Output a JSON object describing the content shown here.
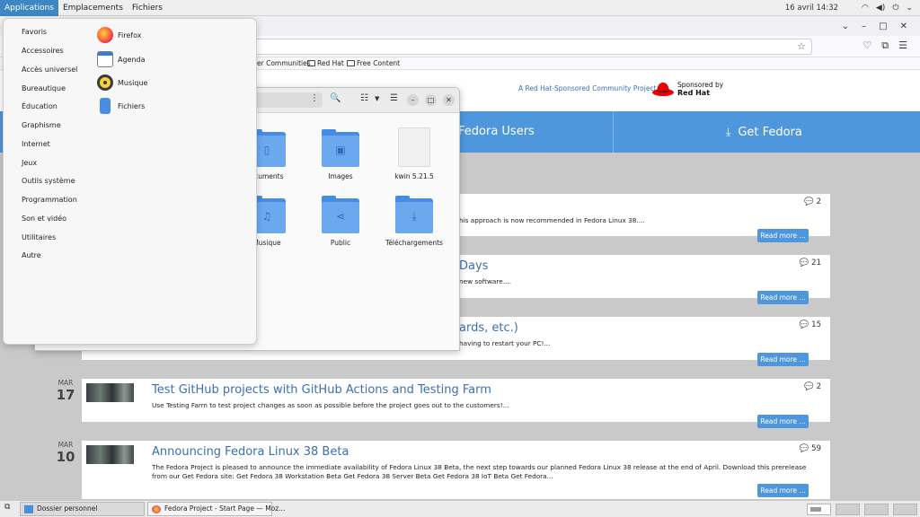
{
  "top_panel": {
    "menus": [
      "Applications",
      "Emplacements",
      "Fichiers"
    ],
    "datetime": "16 avril 14:32",
    "tray_icons": [
      "wifi-icon",
      "volume-icon",
      "power-icon",
      "chevron-down-icon"
    ]
  },
  "app_menu": {
    "categories": [
      "Favoris",
      "Accessoires",
      "Accès universel",
      "Bureautique",
      "Éducation",
      "Graphisme",
      "Internet",
      "Jeux",
      "Outils système",
      "Programmation",
      "Son et vidéo",
      "Utilitaires",
      "Autre"
    ],
    "apps": [
      "Firefox",
      "Agenda",
      "Musique",
      "Fichiers"
    ]
  },
  "browser": {
    "bookmarks": [
      "er Communities",
      "Red Hat",
      "Free Content"
    ],
    "sponsor_text": "A Red Hat-Sponsored Community Project",
    "sponsor_by": "Sponsored by",
    "sponsor_brand": "Red Hat",
    "nav": [
      "Fedora Users",
      "Get Fedora"
    ],
    "read_more": "Read more ...",
    "posts": [
      {
        "month": "",
        "day": "",
        "title": "",
        "excerpt": "his approach is now recommended in Fedora Linux 38....",
        "comments": "2"
      },
      {
        "month": "",
        "day": "",
        "title": "Days",
        "excerpt": "new software....",
        "comments": "21"
      },
      {
        "month": "",
        "day": "",
        "title": "ards, etc.)",
        "excerpt": "having to restart your PC!...",
        "comments": "15"
      },
      {
        "month": "MAR",
        "day": "17",
        "title": "Test GitHub projects with GitHub Actions and Testing Farm",
        "excerpt": "Use Testing Farm to test project changes as soon as possible before the project goes out to the customers!...",
        "comments": "2"
      },
      {
        "month": "MAR",
        "day": "10",
        "title": "Announcing Fedora Linux 38 Beta",
        "excerpt": "The Fedora Project is pleased to announce the immediate availability of Fedora Linux 38 Beta, the next step towards our planned Fedora Linux 38 release at the end of April. Download this prerelease from our Get Fedora site: Get Fedora 38 Workstation Beta  Get Fedora 38 Server Beta Get Fedora 38 IoT Beta Get Fedora...",
        "comments": "59"
      }
    ]
  },
  "file_manager": {
    "items": [
      {
        "label": "ocuments",
        "icon": "document-icon"
      },
      {
        "label": "Images",
        "icon": "image-icon"
      },
      {
        "label": "kwin 5.21.5",
        "icon": "file-icon"
      },
      {
        "label": "Musique",
        "icon": "music-icon"
      },
      {
        "label": "Public",
        "icon": "share-icon"
      },
      {
        "label": "Téléchargements",
        "icon": "download-icon"
      }
    ]
  },
  "taskbar": {
    "tasks": [
      "Dossier personnel",
      "Fedora Project - Start Page — Moz..."
    ],
    "workspaces": 4
  }
}
